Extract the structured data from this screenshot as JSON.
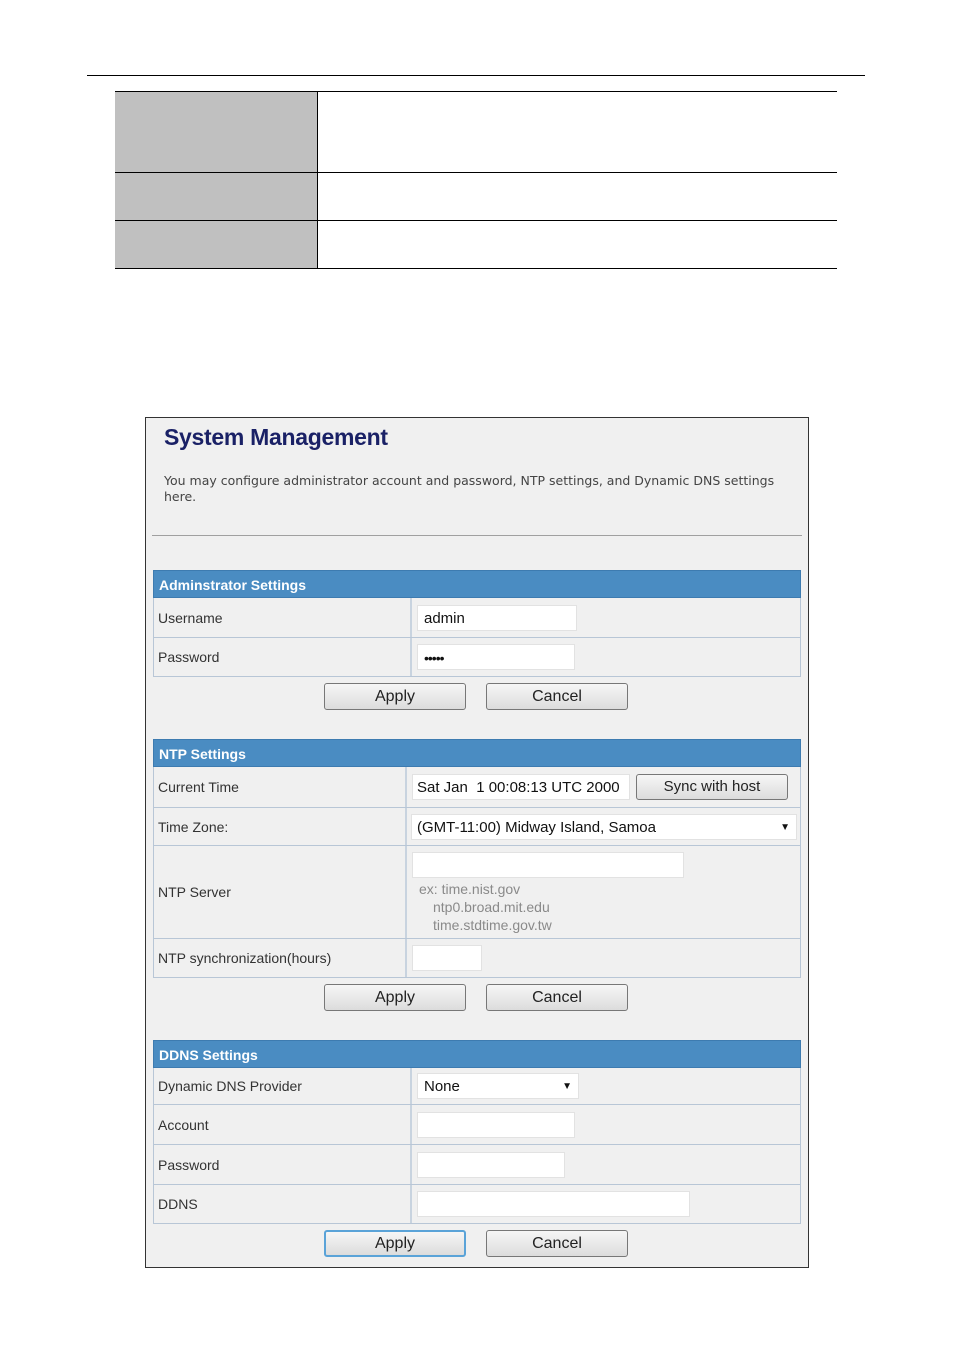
{
  "document_table": {
    "rows": [
      {
        "label": "",
        "value": ""
      },
      {
        "label": "",
        "value": ""
      },
      {
        "label": "",
        "value": ""
      }
    ]
  },
  "panel": {
    "title": "System Management",
    "description": "You may configure administrator account and password, NTP settings, and Dynamic DNS settings here."
  },
  "admin": {
    "header": "Adminstrator Settings",
    "username_label": "Username",
    "username_value": "admin",
    "password_label": "Password",
    "password_value": "•••••",
    "apply_label": "Apply",
    "cancel_label": "Cancel"
  },
  "ntp": {
    "header": "NTP Settings",
    "current_time_label": "Current Time",
    "current_time_value": "Sat Jan  1 00:08:13 UTC 2000",
    "sync_label": "Sync with host",
    "timezone_label": "Time Zone:",
    "timezone_value": "(GMT-11:00) Midway Island, Samoa",
    "server_label": "NTP Server",
    "server_value": "",
    "server_hint_1": "ex: time.nist.gov",
    "server_hint_2": "ntp0.broad.mit.edu",
    "server_hint_3": "time.stdtime.gov.tw",
    "sync_hours_label": "NTP synchronization(hours)",
    "sync_hours_value": "",
    "apply_label": "Apply",
    "cancel_label": "Cancel"
  },
  "ddns": {
    "header": "DDNS Settings",
    "provider_label": "Dynamic DNS Provider",
    "provider_value": "None",
    "account_label": "Account",
    "account_value": "",
    "password_label": "Password",
    "password_value": "",
    "ddns_label": "DDNS",
    "ddns_value": "",
    "apply_label": "Apply",
    "cancel_label": "Cancel"
  },
  "icons": {
    "dropdown": "▼"
  }
}
